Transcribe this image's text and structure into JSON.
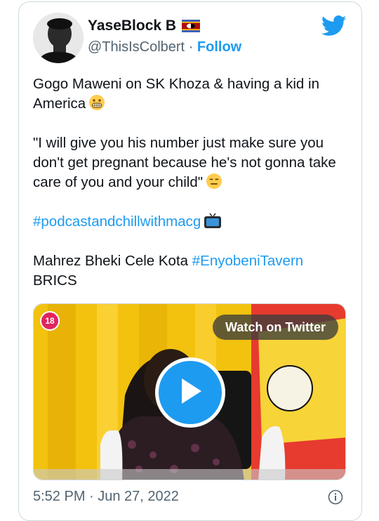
{
  "user": {
    "name": "YaseBlock B",
    "handle": "@ThisIsColbert",
    "separator": "·",
    "follow_label": "Follow"
  },
  "tweet": {
    "line1": "Gogo Maweni on SK Khoza & having a kid in America",
    "quote": "\"I will give you his number just make sure you don't get pregnant because he's not gonna take care of you and your child\"",
    "hashtag1": "#podcastandchillwithmacg",
    "tags_prefix": "Mahrez Bheki Cele Kota",
    "hashtag2": "#EnyobeniTavern",
    "tags_suffix": "BRICS"
  },
  "media": {
    "age_badge": "18",
    "watch_label": "Watch on Twitter"
  },
  "footer": {
    "timestamp": "5:52 PM · Jun 27, 2022"
  },
  "icons": {
    "bird": "twitter-bird-icon",
    "flag": "eswatini-flag-icon",
    "emoji1": "grimacing-face-icon",
    "emoji2": "expressionless-face-icon",
    "emoji3": "television-icon",
    "play": "play-icon",
    "info": "info-icon"
  },
  "colors": {
    "accent": "#1d9bf0",
    "text": "#0f1419",
    "muted": "#536471",
    "badge": "#e0245e"
  }
}
